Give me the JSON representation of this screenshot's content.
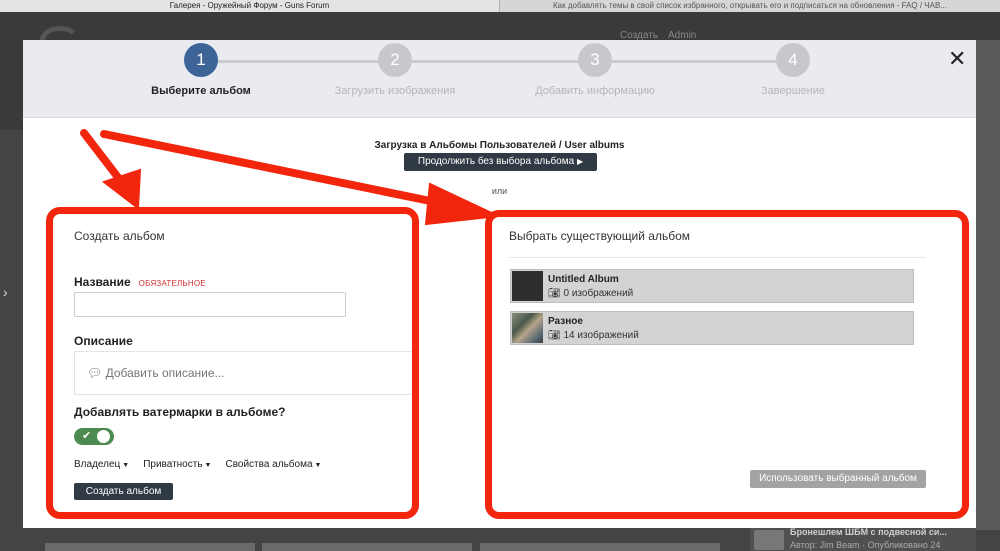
{
  "browser": {
    "tabs": [
      "Галерея - Оружейный Форум - Guns Forum",
      "Как добавлять темы в свой список избранного, открывать его и подписаться на обновления - FAQ / ЧАВ..."
    ]
  },
  "background": {
    "topnav": [
      "Создать",
      "Admin"
    ],
    "article_title": "Бронешлем ШБМ с подвесной си...",
    "article_meta": "Автор: Jim Beam · Опубликовано 24"
  },
  "wizard": {
    "steps": [
      {
        "number": "1",
        "label": "Выберите альбом"
      },
      {
        "number": "2",
        "label": "Загрузить изображения"
      },
      {
        "number": "3",
        "label": "Добавить информацию"
      },
      {
        "number": "4",
        "label": "Завершение"
      }
    ],
    "active_step": 1,
    "close_symbol": "✕"
  },
  "upload": {
    "title": "Загрузка в Альбомы Пользователей / User albums",
    "continue_label": "Продолжить без выбора альбома",
    "or_label": "или"
  },
  "create_album": {
    "title": "Создать альбом",
    "name_label": "Название",
    "required_label": "ОБЯЗАТЕЛЬНОЕ",
    "name_value": "",
    "description_label": "Описание",
    "description_placeholder": "Добавить описание...",
    "watermark_label": "Добавлять ватермарки в альбоме?",
    "watermark_enabled": true,
    "menus": [
      "Владелец",
      "Приватность",
      "Свойства альбома"
    ],
    "create_button": "Создать альбом"
  },
  "existing_album": {
    "title": "Выбрать существующий альбом",
    "albums": [
      {
        "name": "Untitled Album",
        "count": "0 изображений"
      },
      {
        "name": "Разное",
        "count": "14 изображений"
      }
    ],
    "use_button": "Использовать выбранный альбом"
  },
  "colors": {
    "highlight": "#f2250d",
    "active_step": "#3d6496",
    "toggle_on": "#4c8a4f"
  }
}
